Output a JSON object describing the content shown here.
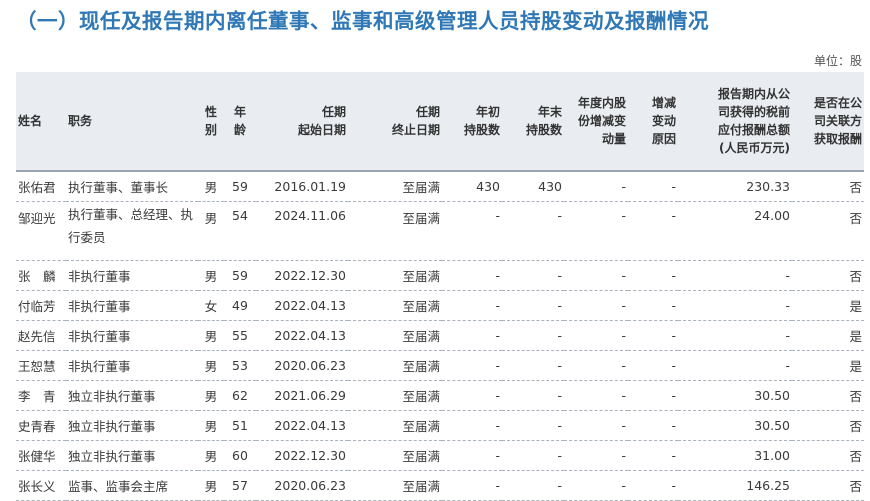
{
  "title": "（一）现任及报告期内离任董事、监事和高级管理人员持股变动及报酬情况",
  "unit": "单位：股",
  "headers": {
    "name": "姓名",
    "position": "职务",
    "gender": "性\n别",
    "age": "年\n龄",
    "start": "任期\n起始日期",
    "end": "任期\n终止日期",
    "shares_begin": "年初\n持股数",
    "shares_end": "年末\n持股数",
    "change": "年度内股\n份增减变\n动量",
    "reason": "增减\n变动\n原因",
    "pay": "报告期内从公\n司获得的税前\n应付报酬总额\n(人民币万元)",
    "related": "是否在公\n司关联方\n获取报酬"
  },
  "rows": [
    {
      "name": "张佑君",
      "position": "执行董事、董事长",
      "gender": "男",
      "age": "59",
      "start": "2016.01.19",
      "end": "至届满",
      "shares_begin": "430",
      "shares_end": "430",
      "change": "-",
      "reason": "-",
      "pay": "230.33",
      "related": "否"
    },
    {
      "name": "邹迎光",
      "position": "执行董事、总经理、执行委员",
      "gender": "男",
      "age": "54",
      "start": "2024.11.06",
      "end": "至届满",
      "shares_begin": "-",
      "shares_end": "-",
      "change": "-",
      "reason": "-",
      "pay": "24.00",
      "related": "否"
    },
    {
      "name": "张　麟",
      "position": "非执行董事",
      "gender": "男",
      "age": "59",
      "start": "2022.12.30",
      "end": "至届满",
      "shares_begin": "-",
      "shares_end": "-",
      "change": "-",
      "reason": "-",
      "pay": "-",
      "related": "否"
    },
    {
      "name": "付临芳",
      "position": "非执行董事",
      "gender": "女",
      "age": "49",
      "start": "2022.04.13",
      "end": "至届满",
      "shares_begin": "-",
      "shares_end": "-",
      "change": "-",
      "reason": "-",
      "pay": "-",
      "related": "是"
    },
    {
      "name": "赵先信",
      "position": "非执行董事",
      "gender": "男",
      "age": "55",
      "start": "2022.04.13",
      "end": "至届满",
      "shares_begin": "-",
      "shares_end": "-",
      "change": "-",
      "reason": "-",
      "pay": "-",
      "related": "是"
    },
    {
      "name": "王恕慧",
      "position": "非执行董事",
      "gender": "男",
      "age": "53",
      "start": "2020.06.23",
      "end": "至届满",
      "shares_begin": "-",
      "shares_end": "-",
      "change": "-",
      "reason": "-",
      "pay": "-",
      "related": "是"
    },
    {
      "name": "李　青",
      "position": "独立非执行董事",
      "gender": "男",
      "age": "62",
      "start": "2021.06.29",
      "end": "至届满",
      "shares_begin": "-",
      "shares_end": "-",
      "change": "-",
      "reason": "-",
      "pay": "30.50",
      "related": "否"
    },
    {
      "name": "史青春",
      "position": "独立非执行董事",
      "gender": "男",
      "age": "51",
      "start": "2022.04.13",
      "end": "至届满",
      "shares_begin": "-",
      "shares_end": "-",
      "change": "-",
      "reason": "-",
      "pay": "30.50",
      "related": "否"
    },
    {
      "name": "张健华",
      "position": "独立非执行董事",
      "gender": "男",
      "age": "60",
      "start": "2022.12.30",
      "end": "至届满",
      "shares_begin": "-",
      "shares_end": "-",
      "change": "-",
      "reason": "-",
      "pay": "31.00",
      "related": "否"
    },
    {
      "name": "张长义",
      "position": "监事、监事会主席",
      "gender": "男",
      "age": "57",
      "start": "2020.06.23",
      "end": "至届满",
      "shares_begin": "-",
      "shares_end": "-",
      "change": "-",
      "reason": "-",
      "pay": "146.25",
      "related": "否"
    }
  ]
}
